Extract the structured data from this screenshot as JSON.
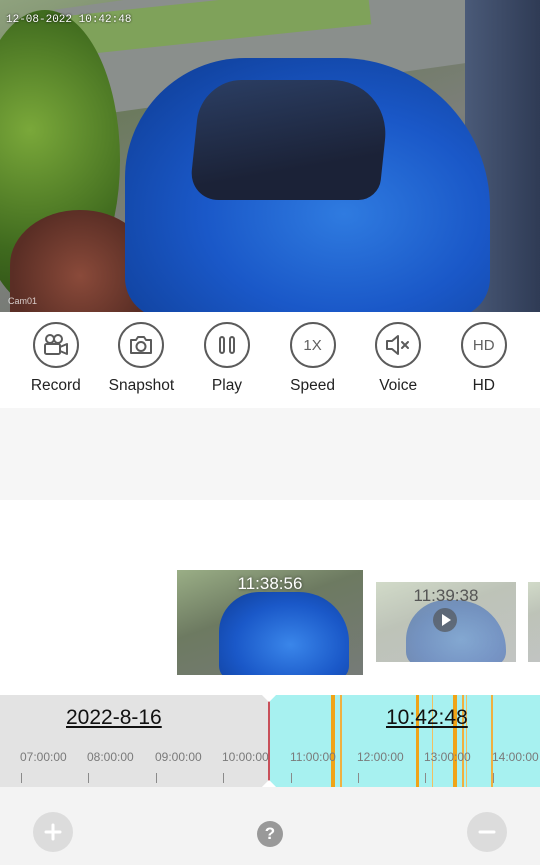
{
  "video": {
    "timestamp": "12-08-2022 10:42:48",
    "watermark": "Cam01"
  },
  "toolbar": [
    {
      "label": "Record",
      "icon": "video-camera-icon"
    },
    {
      "label": "Snapshot",
      "icon": "camera-icon"
    },
    {
      "label": "Play",
      "icon": "pause-icon"
    },
    {
      "label": "Speed",
      "icon": "speed-icon",
      "icon_text": "1X"
    },
    {
      "label": "Voice",
      "icon": "speaker-muted-icon"
    },
    {
      "label": "HD",
      "icon": "hd-icon",
      "icon_text": "HD"
    }
  ],
  "thumbnails": [
    {
      "time": "11:38:56"
    },
    {
      "time": "11:39:38"
    }
  ],
  "timeline": {
    "date": "2022-8-16",
    "current_time": "10:42:48",
    "ticks": [
      "07:00:00",
      "08:00:00",
      "09:00:00",
      "10:00:00",
      "11:00:00",
      "12:00:00",
      "13:00:00",
      "14:00:00"
    ],
    "colors": {
      "recorded": "#a7f1f0",
      "event": "#f0a418",
      "past": "#e3e3e3",
      "cursor": "#c8505a"
    }
  },
  "bottom": {
    "zoom_in": "plus-icon",
    "help": "?",
    "zoom_out": "minus-icon"
  }
}
